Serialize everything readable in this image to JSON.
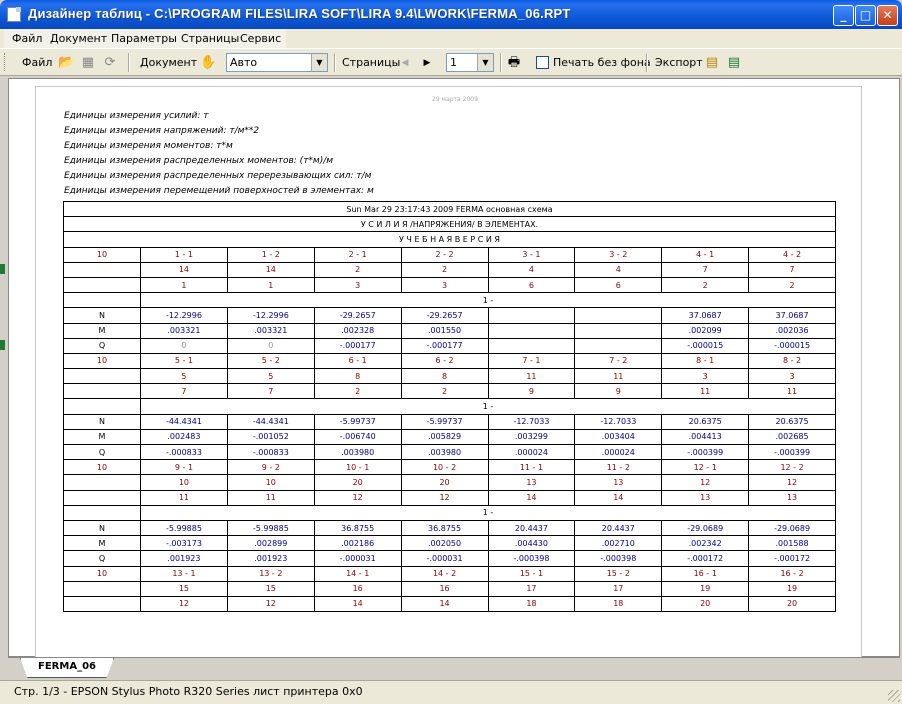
{
  "window": {
    "title": "Дизайнер таблиц - C:\\PROGRAM FILES\\LIRA SOFT\\LIRA 9.4\\LWORK\\FERMA_06.RPT",
    "minimize": "_",
    "maximize": "□",
    "close": "✕"
  },
  "menu": {
    "items": [
      {
        "label": "Файл"
      },
      {
        "label": "Документ"
      },
      {
        "label": "Параметры"
      },
      {
        "label": "Страницы"
      },
      {
        "label": "Сервис"
      }
    ]
  },
  "toolbar": {
    "file_label": "Файл",
    "document_label": "Документ",
    "mode_value": "Авто",
    "pages_label": "Страницы",
    "page_value": "1",
    "print_no_bg_label": "Печать без фона",
    "print_no_bg_checked": false,
    "export_label": "Экспорт"
  },
  "page": {
    "date": "29 марта 2009",
    "units": [
      "Единицы измерения усилий: т",
      "Единицы измерения напряжений: т/м**2",
      "Единицы измерения моментов: т*м",
      "Единицы измерения распределенных моментов: (т*м)/м",
      "Единицы измерения распределенных перерезывающих сил: т/м",
      "Единицы измерения перемещений поверхностей в элементах: м"
    ],
    "report_header": "Sun Mar 29 23:17:43 2009  FERMA  основная схема",
    "report_title": "У С И Л И Я /НАПРЯЖЕНИЯ/ В  ЭЛЕМЕНТАХ.",
    "report_version": "У Ч Е Б Н А Я   В Е Р С И Я",
    "blocks": [
      {
        "col_header": "10",
        "elems": [
          "1 - 1",
          "1 - 2",
          "2 - 1",
          "2 - 2",
          "3 - 1",
          "3 - 2",
          "4 - 1",
          "4 - 2"
        ],
        "row2": [
          "14",
          "14",
          "2",
          "2",
          "4",
          "4",
          "7",
          "7"
        ],
        "row3": [
          "1",
          "1",
          "3",
          "3",
          "6",
          "6",
          "2",
          "2"
        ],
        "load": "1 -",
        "rows": [
          {
            "name": "N",
            "vals": [
              "-12.2996",
              "-12.2996",
              "-29.2657",
              "-29.2657",
              "",
              "",
              "37.0687",
              "37.0687"
            ]
          },
          {
            "name": "M",
            "vals": [
              ".003321",
              ".003321",
              ".002328",
              ".001550",
              "",
              "",
              ".002099",
              ".002036"
            ]
          },
          {
            "name": "Q",
            "vals": [
              "0",
              "0",
              "-.000177",
              "-.000177",
              "",
              "",
              "-.000015",
              "-.000015"
            ]
          }
        ]
      },
      {
        "col_header": "10",
        "elems": [
          "5 - 1",
          "5 - 2",
          "6 - 1",
          "6 - 2",
          "7 - 1",
          "7 - 2",
          "8 - 1",
          "8 - 2"
        ],
        "row2": [
          "5",
          "5",
          "8",
          "8",
          "11",
          "11",
          "3",
          "3"
        ],
        "row3": [
          "7",
          "7",
          "2",
          "2",
          "9",
          "9",
          "11",
          "11"
        ],
        "load": "1 -",
        "rows": [
          {
            "name": "N",
            "vals": [
              "-44.4341",
              "-44.4341",
              "-5.99737",
              "-5.99737",
              "-12.7033",
              "-12.7033",
              "20.6375",
              "20.6375"
            ]
          },
          {
            "name": "M",
            "vals": [
              ".002483",
              "-.001052",
              "-.006740",
              ".005829",
              ".003299",
              ".003404",
              ".004413",
              ".002685"
            ]
          },
          {
            "name": "Q",
            "vals": [
              "-.000833",
              "-.000833",
              ".003980",
              ".003980",
              ".000024",
              ".000024",
              "-.000399",
              "-.000399"
            ]
          }
        ]
      },
      {
        "col_header": "10",
        "elems": [
          "9 - 1",
          "9 - 2",
          "10 - 1",
          "10 - 2",
          "11 - 1",
          "11 - 2",
          "12 - 1",
          "12 - 2"
        ],
        "row2": [
          "10",
          "10",
          "20",
          "20",
          "13",
          "13",
          "12",
          "12"
        ],
        "row3": [
          "11",
          "11",
          "12",
          "12",
          "14",
          "14",
          "13",
          "13"
        ],
        "load": "1 -",
        "rows": [
          {
            "name": "N",
            "vals": [
              "-5.99885",
              "-5.99885",
              "36.8755",
              "36.8755",
              "20.4437",
              "20.4437",
              "-29.0689",
              "-29.0689"
            ]
          },
          {
            "name": "M",
            "vals": [
              "-.003173",
              ".002899",
              ".002186",
              ".002050",
              ".004430",
              ".002710",
              ".002342",
              ".001588"
            ]
          },
          {
            "name": "Q",
            "vals": [
              ".001923",
              ".001923",
              "-.000031",
              "-.000031",
              "-.000398",
              "-.000398",
              "-.000172",
              "-.000172"
            ]
          }
        ]
      },
      {
        "col_header": "10",
        "elems": [
          "13 - 1",
          "13 - 2",
          "14 - 1",
          "14 - 2",
          "15 - 1",
          "15 - 2",
          "16 - 1",
          "16 - 2"
        ],
        "row2": [
          "15",
          "15",
          "16",
          "16",
          "17",
          "17",
          "19",
          "19"
        ],
        "row3": [
          "12",
          "12",
          "14",
          "14",
          "18",
          "18",
          "20",
          "20"
        ],
        "load": null,
        "rows": []
      }
    ]
  },
  "tabs": [
    {
      "label": "FERMA_06"
    }
  ],
  "status": {
    "text": "Стр. 1/3 - EPSON Stylus Photo R320 Series  лист принтера 0x0"
  }
}
